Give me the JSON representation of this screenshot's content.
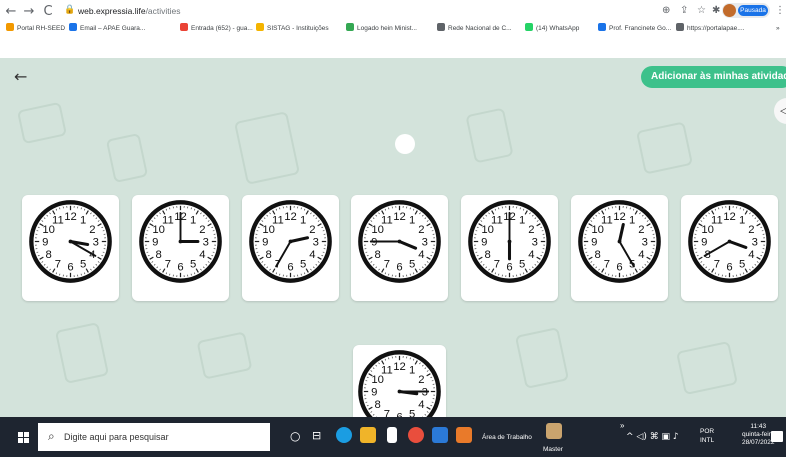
{
  "browser": {
    "nav": {
      "back": "←",
      "forward": "→",
      "reload": "C"
    },
    "url_host": "web.expressia.life",
    "url_path": "/activities",
    "profile_status": "Pausada",
    "bookmarks": [
      {
        "label": "Portal RH-SEED",
        "color": "#f29900"
      },
      {
        "label": "Email – APAE Guara...",
        "color": "#1a73e8"
      },
      {
        "label": "Entrada (652) - gua...",
        "color": "#ea4335"
      },
      {
        "label": "SISTAG - Instituições",
        "color": "#f4b400"
      },
      {
        "label": "Logado hein Minist...",
        "color": "#34a853"
      },
      {
        "label": "Rede Nacional de C...",
        "color": "#5f6368"
      },
      {
        "label": "(14) WhatsApp",
        "color": "#25d366"
      },
      {
        "label": "Prof. Francinete Go...",
        "color": "#1a73e8"
      },
      {
        "label": "https://portalapae....",
        "color": "#5f6368"
      }
    ],
    "more": "»"
  },
  "app": {
    "back": "←",
    "add_button": "Adicionar às minhas atividades",
    "sound": "◁"
  },
  "clocks": [
    {
      "hour": 3,
      "minute": 20
    },
    {
      "hour": 3,
      "minute": 0
    },
    {
      "hour": 2,
      "minute": 35
    },
    {
      "hour": 3,
      "minute": 45
    },
    {
      "hour": 6,
      "minute": 0
    },
    {
      "hour": 12,
      "minute": 25
    },
    {
      "hour": 3,
      "minute": 40
    }
  ],
  "answer_clock": {
    "hour": 3,
    "minute": 15
  },
  "dial_numbers": [
    "12",
    "1",
    "2",
    "3",
    "4",
    "5",
    "6",
    "7",
    "8",
    "9",
    "10",
    "11"
  ],
  "taskbar": {
    "search_placeholder": "Digite aqui para pesquisar",
    "desktop_label": "Área de Trabalho",
    "master_label": "Master",
    "lang": "POR",
    "layout": "INTL",
    "time": "11:43",
    "weekday": "quinta-feira",
    "date": "28/07/2022"
  },
  "colors": {
    "accent": "#3dc18b",
    "stage": "#d3e3db",
    "taskbar": "#1e2530"
  }
}
